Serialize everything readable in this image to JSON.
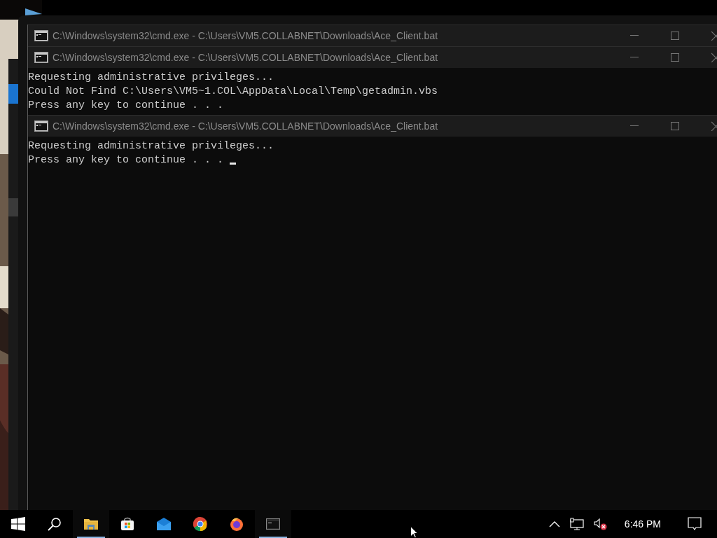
{
  "windows": [
    {
      "title": "C:\\Windows\\system32\\cmd.exe - C:\\Users\\VM5.COLLABNET\\Downloads\\Ace_Client.bat"
    },
    {
      "title": "C:\\Windows\\system32\\cmd.exe - C:\\Users\\VM5.COLLABNET\\Downloads\\Ace_Client.bat",
      "lines": [
        "Requesting administrative privileges...",
        "Could Not Find C:\\Users\\VM5~1.COL\\AppData\\Local\\Temp\\getadmin.vbs",
        "Press any key to continue . . ."
      ]
    },
    {
      "title": "C:\\Windows\\system32\\cmd.exe - C:\\Users\\VM5.COLLABNET\\Downloads\\Ace_Client.bat",
      "lines": [
        "Requesting administrative privileges...",
        "Press any key to continue . . ."
      ],
      "cursor": true
    }
  ],
  "taskbar": {
    "apps": [
      {
        "kind": "start",
        "running": false
      },
      {
        "kind": "search",
        "running": false
      },
      {
        "kind": "explorer",
        "running": true
      },
      {
        "kind": "store",
        "running": false
      },
      {
        "kind": "mail",
        "running": false
      },
      {
        "kind": "chrome",
        "running": false
      },
      {
        "kind": "firefox",
        "running": false
      },
      {
        "kind": "terminal",
        "running": true
      }
    ],
    "clock": "6:46 PM",
    "sound_muted": true
  }
}
